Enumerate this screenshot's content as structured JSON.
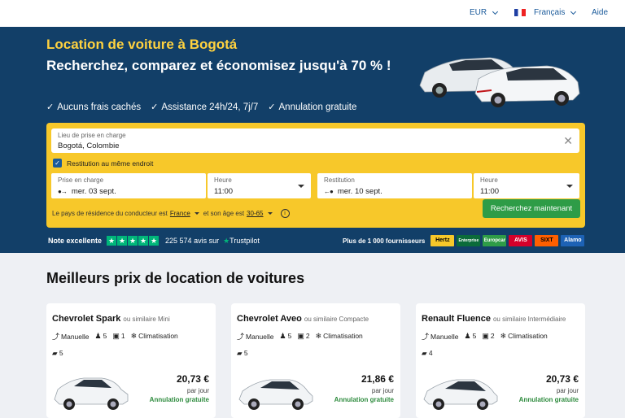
{
  "topbar": {
    "currency": "EUR",
    "language": "Français",
    "help": "Aide"
  },
  "hero": {
    "title": "Location de voiture à Bogotá",
    "subtitle": "Recherchez, comparez et économisez jusqu'à 70 % !",
    "features": [
      "Aucuns frais cachés",
      "Assistance 24h/24, 7j/7",
      "Annulation gratuite"
    ]
  },
  "search": {
    "pickup_location_label": "Lieu de prise en charge",
    "pickup_location_value": "Bogotá, Colombie",
    "same_location_label": "Restitution au même endroit",
    "pickup_date_label": "Prise en charge",
    "pickup_date_value": "mer. 03 sept.",
    "pickup_time_label": "Heure",
    "pickup_time_value": "11:00",
    "return_date_label": "Restitution",
    "return_date_value": "mer. 10 sept.",
    "return_time_label": "Heure",
    "return_time_value": "11:00",
    "residence_text_1": "Le pays de résidence du conducteur est",
    "residence_country": "France",
    "residence_text_2": "et son âge est",
    "residence_age": "30-65",
    "search_button": "Recherchez maintenant"
  },
  "trust": {
    "rating_label": "Note excellente",
    "reviews": "225 574 avis sur",
    "trustpilot": "Trustpilot"
  },
  "providers": {
    "label": "Plus de 1 000 fournisseurs",
    "logos": [
      {
        "name": "Hertz",
        "bg": "#f7c82a",
        "fg": "#000"
      },
      {
        "name": "Enterprise",
        "bg": "#0b6b3a",
        "fg": "#fff"
      },
      {
        "name": "Europcar",
        "bg": "#2e9c47",
        "fg": "#fff"
      },
      {
        "name": "AVIS",
        "bg": "#d4002a",
        "fg": "#fff"
      },
      {
        "name": "SIXT",
        "bg": "#ff5f00",
        "fg": "#000"
      },
      {
        "name": "Alamo",
        "bg": "#1d62b5",
        "fg": "#fff"
      }
    ]
  },
  "best": {
    "title": "Meilleurs prix de location de voitures",
    "cards": [
      {
        "name": "Chevrolet Spark",
        "similar": "ou similaire Mini",
        "transmission": "Manuelle",
        "seats": "5",
        "bags_small": "1",
        "ac": "Climatisation",
        "doors": "5",
        "price": "20,73 €",
        "per_day": "par jour",
        "cancel": "Annulation gratuite"
      },
      {
        "name": "Chevrolet Aveo",
        "similar": "ou similaire Compacte",
        "transmission": "Manuelle",
        "seats": "5",
        "bags_small": "2",
        "ac": "Climatisation",
        "doors": "5",
        "price": "21,86 €",
        "per_day": "par jour",
        "cancel": "Annulation gratuite"
      },
      {
        "name": "Renault Fluence",
        "similar": "ou similaire Intermédiaire",
        "transmission": "Manuelle",
        "seats": "5",
        "bags_small": "2",
        "ac": "Climatisation",
        "doors": "4",
        "price": "20,73 €",
        "per_day": "par jour",
        "cancel": "Annulation gratuite"
      }
    ]
  }
}
